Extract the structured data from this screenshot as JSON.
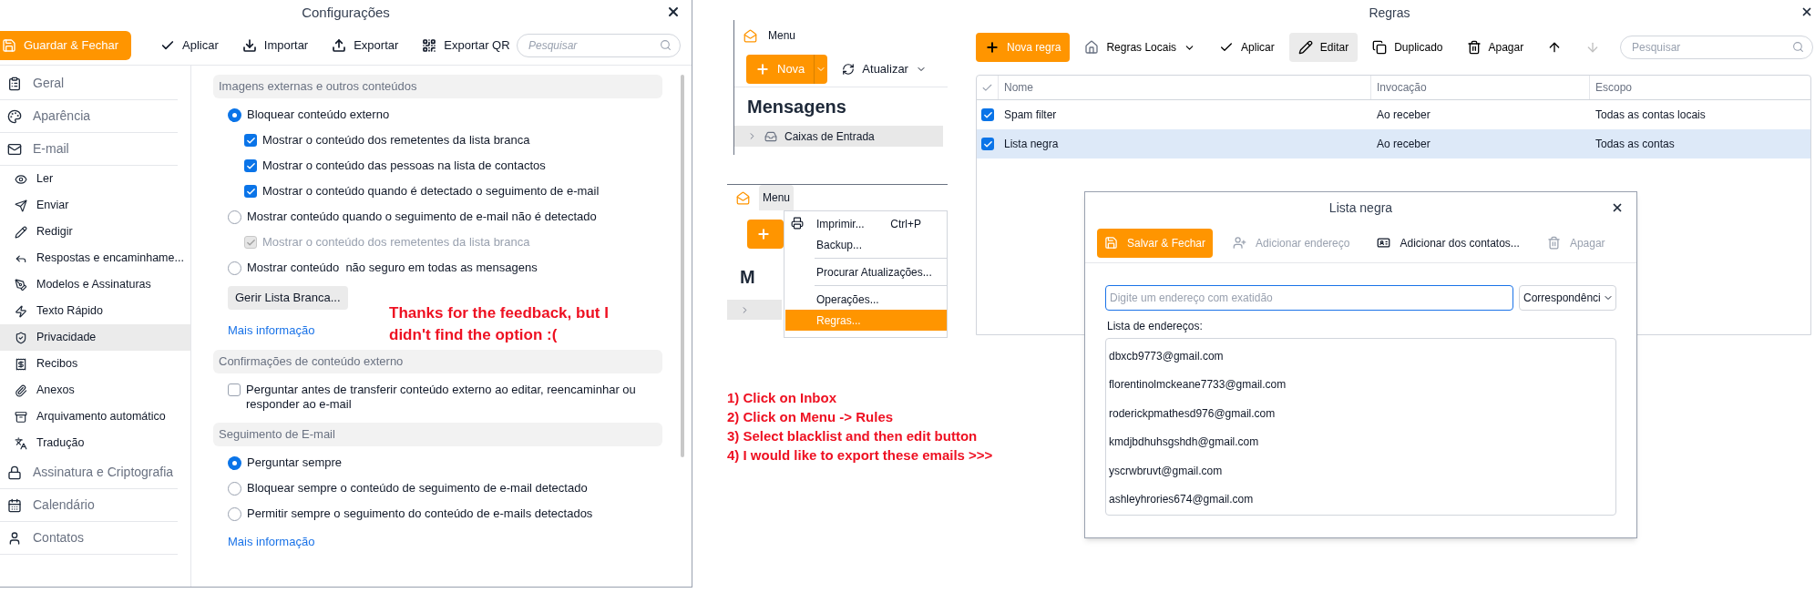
{
  "settings": {
    "title": "Configurações",
    "toolbar": {
      "save": "Guardar & Fechar",
      "buttons": [
        "Aplicar",
        "Importar",
        "Exportar",
        "Exportar QR"
      ],
      "search_placeholder": "Pesquisar"
    },
    "sidebar": [
      {
        "label": "Geral",
        "kind": "section",
        "selected": false
      },
      {
        "label": "Aparência",
        "kind": "section",
        "selected": false
      },
      {
        "label": "E-mail",
        "kind": "section",
        "selected": false
      },
      {
        "label": "Ler",
        "kind": "item",
        "selected": false
      },
      {
        "label": "Enviar",
        "kind": "item",
        "selected": false
      },
      {
        "label": "Redigir",
        "kind": "item",
        "selected": false
      },
      {
        "label": "Respostas e encaminhame...",
        "kind": "item",
        "selected": false
      },
      {
        "label": "Modelos e Assinaturas",
        "kind": "item",
        "selected": false
      },
      {
        "label": "Texto Rápido",
        "kind": "item",
        "selected": false
      },
      {
        "label": "Privacidade",
        "kind": "item",
        "selected": true
      },
      {
        "label": "Recibos",
        "kind": "item",
        "selected": false
      },
      {
        "label": "Anexos",
        "kind": "item",
        "selected": false
      },
      {
        "label": "Arquivamento automático",
        "kind": "item",
        "selected": false
      },
      {
        "label": "Tradução",
        "kind": "item",
        "selected": false
      },
      {
        "label": "Assinatura e Criptografia",
        "kind": "section",
        "selected": false
      },
      {
        "label": "Calendário",
        "kind": "section",
        "selected": false
      },
      {
        "label": "Contatos",
        "kind": "section",
        "selected": false
      }
    ],
    "sections": [
      {
        "heading": "Imagens externas e outros conteúdos",
        "items": [
          {
            "kind": "radio",
            "label": "Bloquear conteúdo externo",
            "checked": true,
            "children": [
              {
                "kind": "checkbox",
                "label": "Mostrar o conteúdo dos remetentes da lista branca",
                "checked": true,
                "disabled": false
              },
              {
                "kind": "checkbox",
                "label": "Mostrar o conteúdo das pessoas na lista de contactos",
                "checked": true,
                "disabled": false
              },
              {
                "kind": "checkbox",
                "label": "Mostrar o conteúdo quando é detectado o seguimento de e-mail",
                "checked": true,
                "disabled": false
              }
            ]
          },
          {
            "kind": "radio",
            "label": "Mostrar conteúdo quando o seguimento de e-mail não é detectado",
            "checked": false,
            "children": [
              {
                "kind": "checkbox",
                "label": "Mostrar o conteúdo dos remetentes da lista branca",
                "checked": true,
                "disabled": true
              }
            ]
          },
          {
            "kind": "radio",
            "label": "Mostrar conteúdo  não seguro em todas as mensagens",
            "checked": false
          },
          {
            "kind": "button",
            "label": "Gerir Lista Branca..."
          },
          {
            "kind": "link",
            "label": "Mais informação"
          }
        ]
      },
      {
        "heading": "Confirmações de conteúdo externo",
        "items": [
          {
            "kind": "checkbox",
            "label": "Perguntar antes de transferir conteúdo externo ao editar, reencaminhar ou responder ao e-mail",
            "checked": false
          }
        ]
      },
      {
        "heading": "Seguimento de E-mail",
        "items": [
          {
            "kind": "radio",
            "label": "Perguntar sempre",
            "checked": true
          },
          {
            "kind": "radio",
            "label": "Bloquear sempre o conteúdo de seguimento de e-mail detectado",
            "checked": false
          },
          {
            "kind": "radio",
            "label": "Permitir sempre o seguimento do conteúdo de e-mails detectados",
            "checked": false
          },
          {
            "kind": "link",
            "label": "Mais informação"
          }
        ]
      }
    ]
  },
  "mail_snippet": {
    "menu_label": "Menu",
    "new_button": "Nova",
    "refresh_button": "Atualizar",
    "heading": "Mensagens",
    "folder": {
      "label": "Caixas de Entrada",
      "selected": true
    }
  },
  "menu_snippet": {
    "menu_label": "Menu",
    "menu_expanded": true,
    "partial_heading": "M",
    "items": [
      {
        "kind": "item",
        "label": "Imprimir...",
        "shortcut": "Ctrl+P",
        "selected": false
      },
      {
        "kind": "item",
        "label": "Backup...",
        "selected": false
      },
      {
        "kind": "separator"
      },
      {
        "kind": "item",
        "label": "Procurar Atualizações...",
        "selected": false
      },
      {
        "kind": "separator"
      },
      {
        "kind": "item",
        "label": "Operações...",
        "selected": false
      },
      {
        "kind": "item",
        "label": "Regras...",
        "selected": true
      }
    ]
  },
  "rules": {
    "title": "Regras",
    "toolbar": [
      {
        "kind": "primary",
        "label": "Nova regra"
      },
      {
        "kind": "dropdown",
        "label": "Regras Locais",
        "pressed": false,
        "disabled": false
      },
      {
        "kind": "plain",
        "label": "Aplicar",
        "pressed": false,
        "disabled": false
      },
      {
        "kind": "plain",
        "label": "Editar",
        "pressed": true,
        "disabled": false
      },
      {
        "kind": "plain",
        "label": "Duplicado",
        "pressed": false,
        "disabled": false
      },
      {
        "kind": "plain",
        "label": "Apagar",
        "pressed": false,
        "disabled": false
      },
      {
        "kind": "icon",
        "pressed": false,
        "disabled": false
      },
      {
        "kind": "icon",
        "pressed": false,
        "disabled": true
      }
    ],
    "search_placeholder": "Pesquisar",
    "columns": [
      "Nome",
      "Invocação",
      "Escopo"
    ],
    "rows": [
      {
        "cells": [
          "Spam filter",
          "Ao receber",
          "Todas as contas locais"
        ],
        "checked": true,
        "selected": false
      },
      {
        "cells": [
          "Lista negra",
          "Ao receber",
          "Todas as contas"
        ],
        "checked": true,
        "selected": true
      }
    ]
  },
  "blacklist_dialog": {
    "title": "Lista negra",
    "toolbar": [
      {
        "kind": "primary",
        "label": "Salvar & Fechar"
      },
      {
        "kind": "plain",
        "label": "Adicionar endereço",
        "disabled": true
      },
      {
        "kind": "plain",
        "label": "Adicionar dos contatos...",
        "disabled": false
      },
      {
        "kind": "plain",
        "label": "Apagar",
        "disabled": true
      }
    ],
    "address_placeholder": "Digite um endereço com exatidão",
    "match_select": "Correspondênci",
    "list_label": "Lista de endereços:",
    "addresses": [
      "dbxcb9773@gmail.com",
      "florentinolmckeane7733@gmail.com",
      "roderickpmathesd976@gmail.com",
      "kmdjbdhuhsgshdh@gmail.com",
      "yscrwbruvt@gmail.com",
      "ashleyhrories674@gmail.com"
    ]
  },
  "annotations": {
    "feedback": [
      "Thanks for the feedback, but I",
      "didn't find the option :("
    ],
    "steps": [
      "1) Click on Inbox",
      "2) Click on Menu -> Rules",
      "3) Select blacklist and then edit button",
      "4) I would like to export these emails >>>"
    ]
  }
}
